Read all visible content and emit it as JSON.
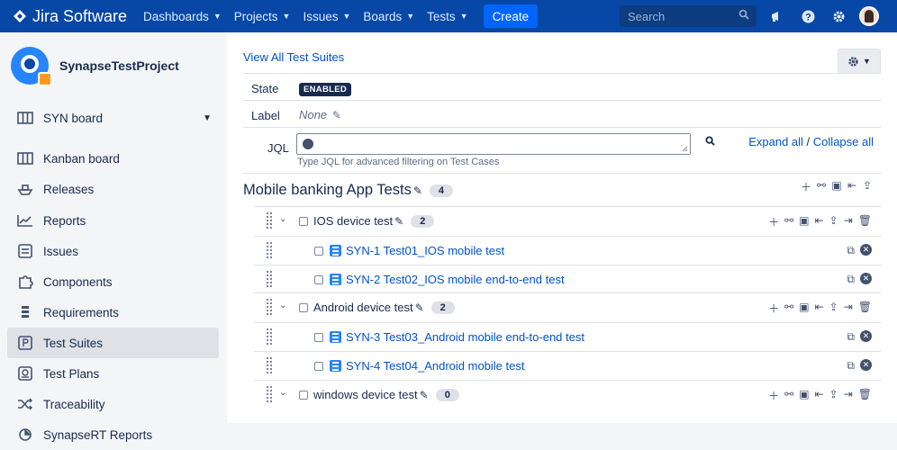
{
  "topnav": {
    "logo_text": "Jira Software",
    "items": [
      {
        "label": "Dashboards"
      },
      {
        "label": "Projects"
      },
      {
        "label": "Issues"
      },
      {
        "label": "Boards"
      },
      {
        "label": "Tests"
      }
    ],
    "create_label": "Create",
    "search_placeholder": "Search",
    "icons": [
      "megaphone-icon",
      "help-icon",
      "gear-icon",
      "user-avatar"
    ]
  },
  "sidebar": {
    "project_name": "SynapseTestProject",
    "board": "SYN board",
    "items": [
      {
        "label": "Kanban board",
        "icon": "kanban-icon"
      },
      {
        "label": "Releases",
        "icon": "ship-icon"
      },
      {
        "label": "Reports",
        "icon": "chart-icon"
      },
      {
        "label": "Issues",
        "icon": "issues-icon"
      },
      {
        "label": "Components",
        "icon": "puzzle-icon"
      },
      {
        "label": "Requirements",
        "icon": "requirements-icon"
      },
      {
        "label": "Test Suites",
        "icon": "test-suites-icon",
        "active": true
      },
      {
        "label": "Test Plans",
        "icon": "test-plans-icon"
      },
      {
        "label": "Traceability",
        "icon": "shuffle-icon"
      },
      {
        "label": "SynapseRT Reports",
        "icon": "report-icon"
      }
    ]
  },
  "main": {
    "view_all": "View All Test Suites",
    "state_label": "State",
    "state_value": "ENABLED",
    "label_label": "Label",
    "label_value": "None",
    "jql_label": "JQL",
    "jql_help": "Type JQL for advanced filtering on Test Cases",
    "expand_all": "Expand all",
    "separator": "/",
    "collapse_all": "Collapse all",
    "suite": {
      "title": "Mobile banking App Tests",
      "count": "4"
    },
    "rows": [
      {
        "type": "group",
        "label": "IOS device test",
        "count": "2"
      },
      {
        "type": "case",
        "label": "SYN-1 Test01_IOS mobile test"
      },
      {
        "type": "case",
        "label": "SYN-2 Test02_IOS mobile end-to-end test"
      },
      {
        "type": "group",
        "label": "Android device test",
        "count": "2"
      },
      {
        "type": "case",
        "label": "SYN-3 Test03_Android mobile end-to-end test"
      },
      {
        "type": "case",
        "label": "SYN-4 Test04_Android mobile test"
      },
      {
        "type": "group",
        "label": "windows device test",
        "count": "0"
      }
    ]
  }
}
